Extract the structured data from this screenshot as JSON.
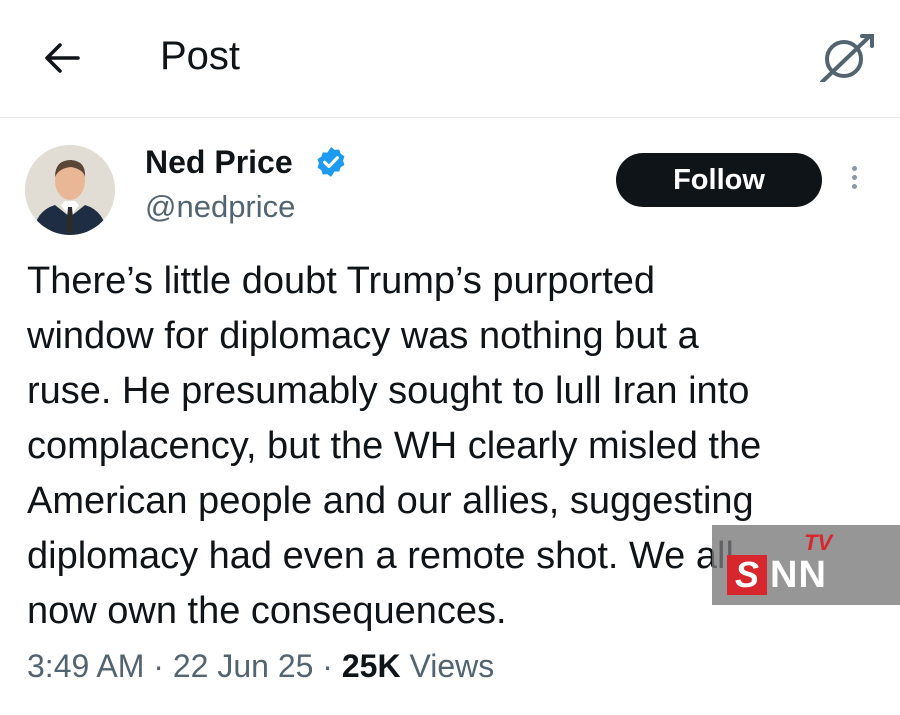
{
  "header": {
    "title": "Post",
    "back_icon": "arrow-left-icon",
    "grok_icon": "grok-icon"
  },
  "author": {
    "name": "Ned Price",
    "handle": "@nedprice",
    "verified": true,
    "verified_color": "#1d9bf0"
  },
  "actions": {
    "follow_label": "Follow",
    "more_icon": "more-vertical-icon"
  },
  "post": {
    "lines": [
      "There’s little doubt Trump’s purported",
      "window for diplomacy was nothing but a",
      "ruse. He presumably sought to lull Iran into",
      "complacency, but the WH clearly misled the",
      "American people and our allies, suggesting",
      "diplomacy had even a remote shot. We all",
      "now own the consequences."
    ]
  },
  "meta": {
    "time": "3:49 AM",
    "date": "22 Jun 25",
    "views_count": "25K",
    "views_label": "Views",
    "separator": "·"
  },
  "watermark": {
    "tv": "TV",
    "s": "S",
    "nn": "NN"
  }
}
